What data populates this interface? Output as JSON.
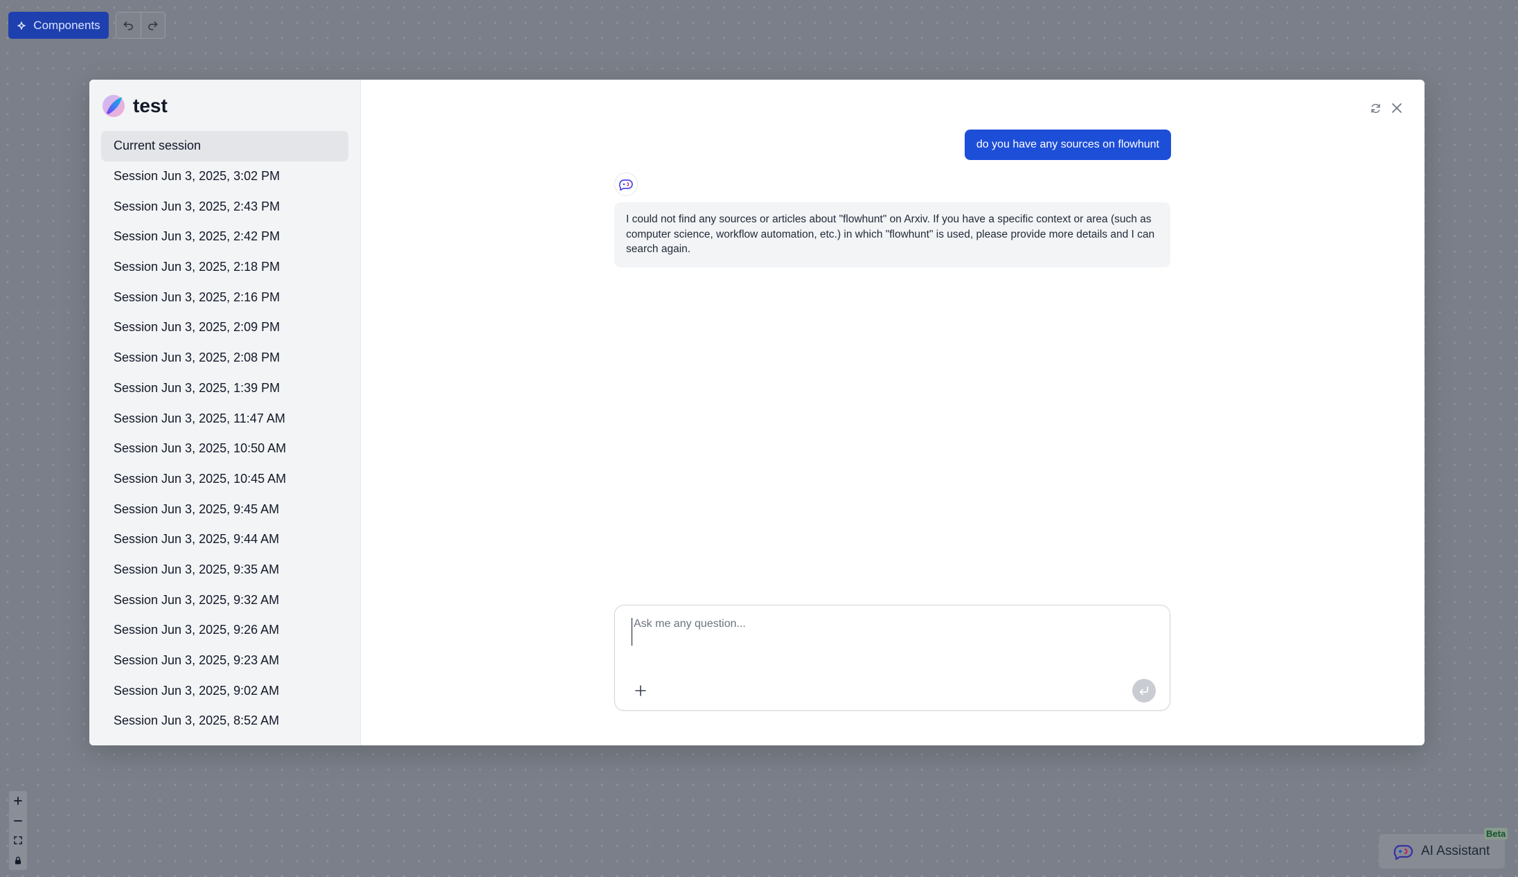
{
  "toolbar": {
    "components_label": "Components",
    "undo_icon": "undo-icon",
    "redo_icon": "redo-icon"
  },
  "modal": {
    "title": "test",
    "sessions": [
      "Current session",
      "Session Jun 3, 2025, 3:02 PM",
      "Session Jun 3, 2025, 2:43 PM",
      "Session Jun 3, 2025, 2:42 PM",
      "Session Jun 3, 2025, 2:18 PM",
      "Session Jun 3, 2025, 2:16 PM",
      "Session Jun 3, 2025, 2:09 PM",
      "Session Jun 3, 2025, 2:08 PM",
      "Session Jun 3, 2025, 1:39 PM",
      "Session Jun 3, 2025, 11:47 AM",
      "Session Jun 3, 2025, 10:50 AM",
      "Session Jun 3, 2025, 10:45 AM",
      "Session Jun 3, 2025, 9:45 AM",
      "Session Jun 3, 2025, 9:44 AM",
      "Session Jun 3, 2025, 9:35 AM",
      "Session Jun 3, 2025, 9:32 AM",
      "Session Jun 3, 2025, 9:26 AM",
      "Session Jun 3, 2025, 9:23 AM",
      "Session Jun 3, 2025, 9:02 AM",
      "Session Jun 3, 2025, 8:52 AM"
    ],
    "active_session_index": 0
  },
  "chat": {
    "user_message": "do you have any sources on flowhunt",
    "bot_message": "I could not find any sources or articles about \"flowhunt\" on Arxiv. If you have a specific context or area (such as computer science, workflow automation, etc.) in which \"flowhunt\" is used, please provide more details and I can search again.",
    "input_placeholder": "Ask me any question...",
    "input_value": ""
  },
  "assistant": {
    "label": "AI Assistant",
    "badge": "Beta"
  },
  "colors": {
    "primary": "#1d4ed8",
    "toolbar_button": "#1e40af",
    "canvas": "#7a7f89",
    "sidebar": "#f3f4f6"
  }
}
